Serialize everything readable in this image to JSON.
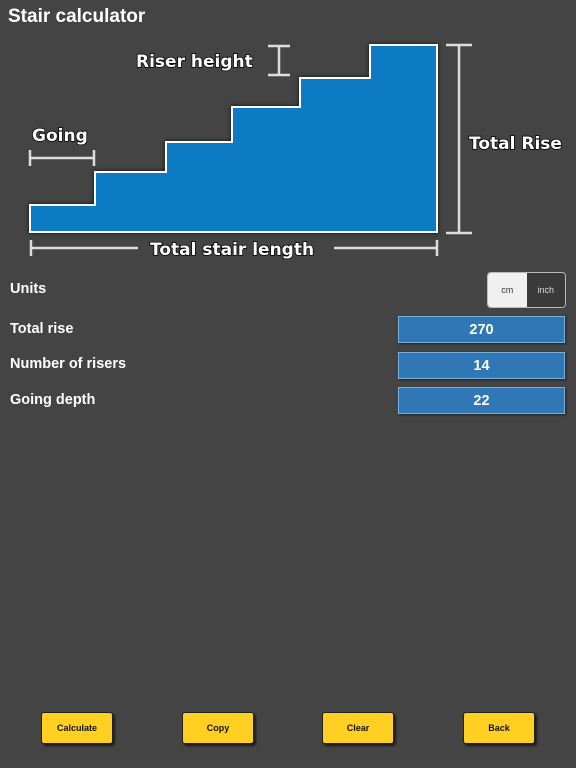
{
  "title": "Stair calculator",
  "diagram": {
    "riser_height_label": "Riser height",
    "going_label": "Going",
    "total_rise_label": "Total Rise",
    "total_length_label": "Total stair length",
    "stair_color": "#0b7ac4"
  },
  "units": {
    "label": "Units",
    "options": [
      "cm",
      "inch"
    ],
    "selected": "cm"
  },
  "fields": {
    "total_rise": {
      "label": "Total rise",
      "value": "270"
    },
    "number_of_risers": {
      "label": "Number of risers",
      "value": "14"
    },
    "going_depth": {
      "label": "Going depth",
      "value": "22"
    }
  },
  "buttons": {
    "calculate": "Calculate",
    "copy": "Copy",
    "clear": "Clear",
    "back": "Back"
  },
  "colors": {
    "background": "#444444",
    "field_fill": "#2f78b5",
    "button_fill": "#ffd021"
  }
}
